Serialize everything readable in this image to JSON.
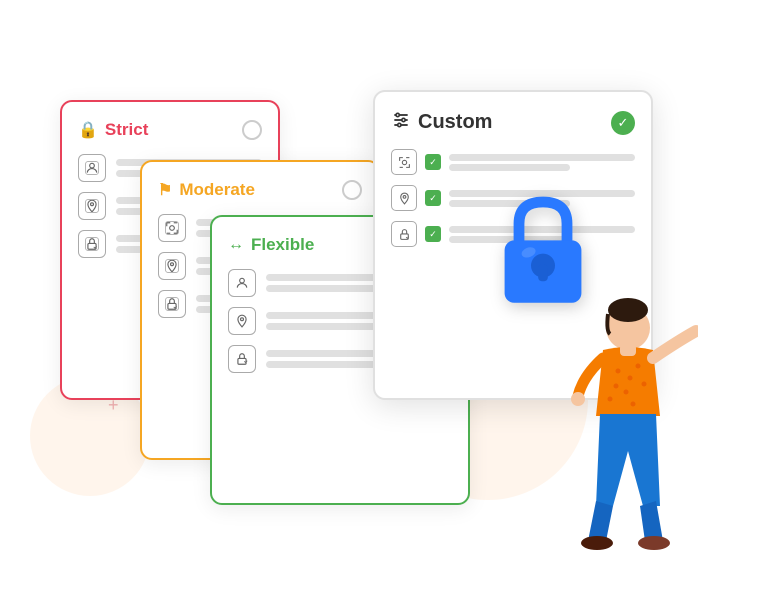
{
  "cards": {
    "strict": {
      "title": "Strict",
      "title_icon": "🔒",
      "border_color": "#e8415a",
      "title_color": "#e8415a",
      "rows": [
        {
          "icon": "👤",
          "lines": [
            "long",
            "short"
          ]
        },
        {
          "icon": "📍",
          "lines": [
            "long",
            "short"
          ]
        },
        {
          "icon": "🔏",
          "lines": [
            "long",
            "short"
          ]
        }
      ]
    },
    "moderate": {
      "title": "Moderate",
      "title_icon": "🚩",
      "border_color": "#f5a623",
      "title_color": "#f5a623",
      "rows": [
        {
          "icon": "👤",
          "lines": [
            "long",
            "short"
          ]
        },
        {
          "icon": "📍",
          "lines": [
            "long",
            "short"
          ]
        },
        {
          "icon": "🔏",
          "lines": [
            "long",
            "short"
          ]
        }
      ]
    },
    "flexible": {
      "title": "Flexible",
      "title_icon": "↔",
      "border_color": "#4caf50",
      "title_color": "#4caf50",
      "rows": [
        {
          "icon": "👤",
          "lines": [
            "long",
            "short"
          ]
        },
        {
          "icon": "📍",
          "lines": [
            "long",
            "short"
          ]
        },
        {
          "icon": "🔏",
          "lines": [
            "long",
            "short"
          ]
        }
      ]
    },
    "custom": {
      "title": "Custom",
      "title_icon": "≡",
      "border_color": "#e0e0e0",
      "title_color": "#333333",
      "rows": [
        {
          "icon": "👤",
          "checked": true,
          "lines": [
            "long",
            "short"
          ]
        },
        {
          "icon": "📍",
          "checked": true,
          "lines": [
            "long",
            "short"
          ]
        },
        {
          "icon": "🔏",
          "checked": true,
          "lines": [
            "long",
            "short"
          ]
        }
      ]
    }
  },
  "decoration": {
    "plus_symbols": [
      "+",
      "+"
    ]
  }
}
